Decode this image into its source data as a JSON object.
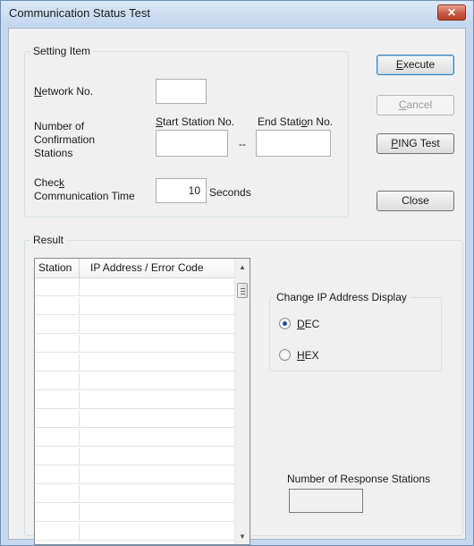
{
  "window": {
    "title": "Communication Status Test",
    "close_glyph": "✕"
  },
  "setting_item": {
    "legend": "Setting Item",
    "network_no": {
      "label_u": "N",
      "label_rest": "etwork No.",
      "value": ""
    },
    "confirmation": {
      "label_line1": "Number of",
      "label_line2": "Confirmation",
      "label_line3": "Stations",
      "start_label_u": "S",
      "start_label_rest": "tart Station No.",
      "end_label_pre": "End Stati",
      "end_label_u": "o",
      "end_label_post": "n No.",
      "range_sep": "--",
      "start_value": "",
      "end_value": ""
    },
    "check_time": {
      "label_pre": "Chec",
      "label_u": "k",
      "label_line2": "Communication Time",
      "value": "10",
      "unit": "Seconds"
    }
  },
  "buttons": {
    "execute_u": "E",
    "execute_rest": "xecute",
    "cancel_u": "C",
    "cancel_rest": "ancel",
    "ping_u": "P",
    "ping_rest": "ING Test",
    "close": "Close"
  },
  "result": {
    "legend": "Result",
    "columns": [
      "Station",
      "IP Address / Error Code"
    ],
    "rows": [
      "",
      "",
      "",
      "",
      "",
      "",
      "",
      "",
      "",
      "",
      "",
      "",
      "",
      ""
    ],
    "ip_display": {
      "legend": "Change IP Address Display",
      "dec_u": "D",
      "dec_rest": "EC",
      "hex_u": "H",
      "hex_rest": "EX",
      "selected": "DEC"
    },
    "response_label": "Number of Response Stations",
    "response_value": ""
  },
  "icons": {
    "scroll_up": "▲",
    "scroll_down": "▼"
  }
}
